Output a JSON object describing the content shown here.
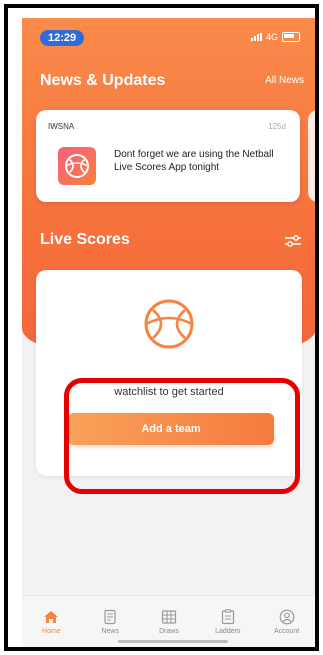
{
  "status": {
    "time": "12:29",
    "network": "4G"
  },
  "news_section": {
    "title": "News & Updates",
    "link": "All News"
  },
  "news_card": {
    "source": "IWSNA",
    "age": "125d",
    "text": "Dont forget we are using the Netball Live Scores App tonight"
  },
  "live_section": {
    "title": "Live Scores"
  },
  "live_card": {
    "message": "watchlist to get started",
    "button": "Add a team"
  },
  "tabs": [
    {
      "label": "Home",
      "icon": "home-icon",
      "active": true
    },
    {
      "label": "News",
      "icon": "news-icon",
      "active": false
    },
    {
      "label": "Draws",
      "icon": "draws-icon",
      "active": false
    },
    {
      "label": "Ladders",
      "icon": "ladders-icon",
      "active": false
    },
    {
      "label": "Account",
      "icon": "account-icon",
      "active": false
    }
  ],
  "colors": {
    "accent": "#f6843f",
    "highlight": "#e60000",
    "time_pill": "#2f6cd9"
  }
}
